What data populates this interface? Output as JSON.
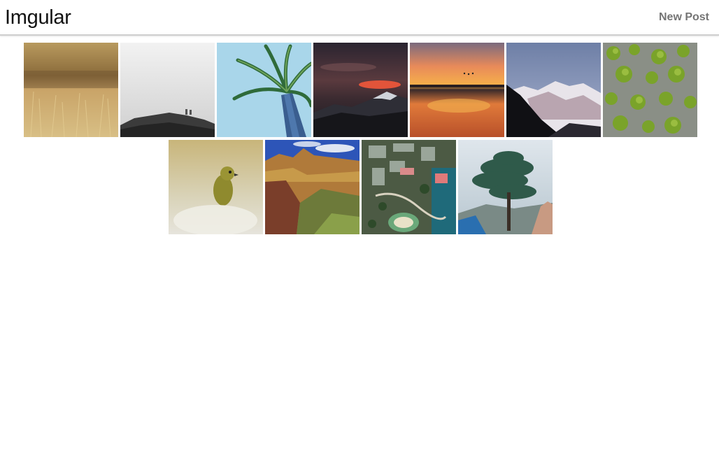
{
  "app": {
    "title": "Imgular",
    "new_post_label": "New Post"
  },
  "gallery": {
    "rows": [
      [
        {
          "name": "field-grass-photo"
        },
        {
          "name": "foggy-rocks-photo"
        },
        {
          "name": "palm-tree-photo"
        },
        {
          "name": "sunset-mountain-photo"
        },
        {
          "name": "beach-sunset-photo"
        },
        {
          "name": "snowy-mountain-photo"
        },
        {
          "name": "moss-rock-photo"
        }
      ],
      [
        {
          "name": "bird-photo"
        },
        {
          "name": "canyon-photo"
        },
        {
          "name": "aerial-city-photo"
        },
        {
          "name": "tree-photo"
        }
      ]
    ]
  }
}
